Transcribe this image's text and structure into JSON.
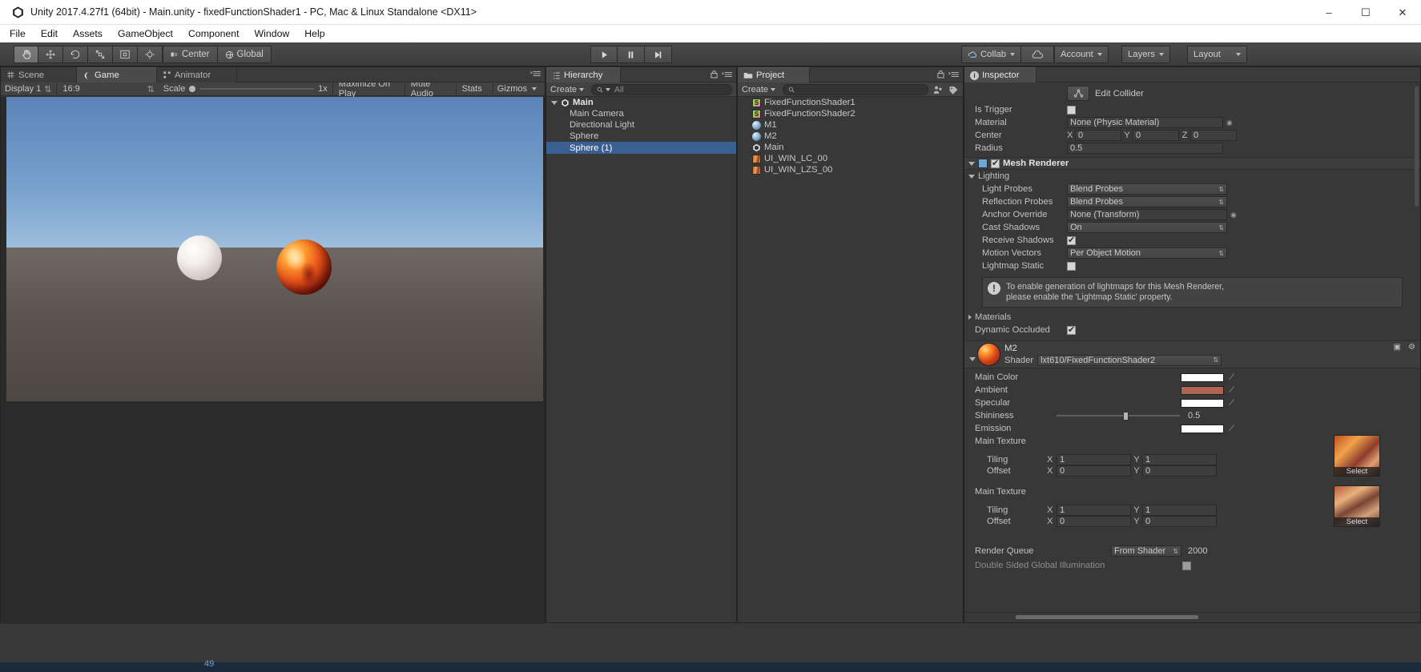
{
  "window": {
    "title": "Unity 2017.4.27f1 (64bit) - Main.unity - fixedFunctionShader1 - PC, Mac & Linux Standalone <DX11>",
    "minimize": "–",
    "maximize": "☐",
    "close": "✕"
  },
  "menu": {
    "items": [
      "File",
      "Edit",
      "Assets",
      "GameObject",
      "Component",
      "Window",
      "Help"
    ]
  },
  "toolbar": {
    "transform_tools": [
      "hand-tool",
      "move-tool",
      "rotate-tool",
      "scale-tool",
      "rect-tool",
      "transform-tool"
    ],
    "pivot_label": "Center",
    "space_label": "Global",
    "play": "▶",
    "pause": "❚❚",
    "step": "▶┃",
    "collab_label": "Collab",
    "cloud_label": "☁",
    "account_label": "Account",
    "layers_label": "Layers",
    "layout_label": "Layout"
  },
  "sceneview": {
    "tabs": [
      {
        "label": "Scene",
        "icon": "scene-grid-icon",
        "active": false
      },
      {
        "label": "Game",
        "icon": "game-pad-icon",
        "active": true
      },
      {
        "label": "Animator",
        "icon": "animator-icon",
        "active": false
      }
    ],
    "display": "Display 1",
    "aspect": "16:9",
    "scale_label": "Scale",
    "scale_value": "1x",
    "maximize_on_play": "Maximize On Play",
    "mute_audio": "Mute Audio",
    "stats": "Stats",
    "gizmos": "Gizmos"
  },
  "hierarchy": {
    "tab": "Hierarchy",
    "create": "Create",
    "search_placeholder": "All",
    "items": [
      {
        "label": "Main",
        "depth": 0,
        "selected": false,
        "icon": "unity-scene-icon",
        "expanded": true
      },
      {
        "label": "Main Camera",
        "depth": 1,
        "selected": false,
        "icon": "none"
      },
      {
        "label": "Directional Light",
        "depth": 1,
        "selected": false,
        "icon": "none"
      },
      {
        "label": "Sphere",
        "depth": 1,
        "selected": false,
        "icon": "none"
      },
      {
        "label": "Sphere (1)",
        "depth": 1,
        "selected": true,
        "icon": "none"
      }
    ]
  },
  "project": {
    "tab": "Project",
    "create": "Create",
    "search_placeholder": "",
    "items": [
      {
        "label": "FixedFunctionShader1",
        "icon": "shader-icon"
      },
      {
        "label": "FixedFunctionShader2",
        "icon": "shader-icon"
      },
      {
        "label": "M1",
        "icon": "material-icon"
      },
      {
        "label": "M2",
        "icon": "material-icon"
      },
      {
        "label": "Main",
        "icon": "unity-scene-icon"
      },
      {
        "label": "UI_WIN_LC_00",
        "icon": "texture-icon"
      },
      {
        "label": "UI_WIN_LZS_00",
        "icon": "texture-icon"
      }
    ]
  },
  "inspector": {
    "tab": "Inspector",
    "edit_collider": "Edit Collider",
    "collider": {
      "is_trigger_label": "Is Trigger",
      "is_trigger_checked": false,
      "material_label": "Material",
      "material_value": "None (Physic Material)",
      "center_label": "Center",
      "center": {
        "x_label": "X",
        "x": "0",
        "y_label": "Y",
        "y": "0",
        "z_label": "Z",
        "z": "0"
      },
      "radius_label": "Radius",
      "radius_value": "0.5"
    },
    "mesh_renderer": {
      "title": "Mesh Renderer",
      "enabled": true,
      "lighting_label": "Lighting",
      "fields": [
        {
          "label": "Light Probes",
          "value": "Blend Probes",
          "type": "popup"
        },
        {
          "label": "Reflection Probes",
          "value": "Blend Probes",
          "type": "popup"
        },
        {
          "label": "Anchor Override",
          "value": "None (Transform)",
          "type": "object"
        },
        {
          "label": "Cast Shadows",
          "value": "On",
          "type": "popup"
        },
        {
          "label": "Receive Shadows",
          "value": "",
          "type": "checkbox",
          "checked": true
        },
        {
          "label": "Motion Vectors",
          "value": "Per Object Motion",
          "type": "popup"
        },
        {
          "label": "Lightmap Static",
          "value": "",
          "type": "checkbox",
          "checked": false
        }
      ],
      "info_line1": "To enable generation of lightmaps for this Mesh Renderer,",
      "info_line2": "please enable the 'Lightmap Static' property.",
      "materials_label": "Materials",
      "dynamic_occluded_label": "Dynamic Occluded",
      "dynamic_occluded_checked": true
    },
    "material": {
      "name": "M2",
      "shader_label": "Shader",
      "shader_value": "lxt610/FixedFunctionShader2",
      "props": [
        {
          "label": "Main Color",
          "type": "color",
          "color": "#ffffff"
        },
        {
          "label": "Ambient",
          "type": "color",
          "color": "#b06454"
        },
        {
          "label": "Specular",
          "type": "color",
          "color": "#ffffff"
        },
        {
          "label": "Shininess",
          "type": "slider",
          "value": "0.5"
        },
        {
          "label": "Emission",
          "type": "color",
          "color": "#ffffff"
        }
      ],
      "textures": [
        {
          "label": "Main Texture",
          "tiling_label": "Tiling",
          "tiling_x_label": "X",
          "tiling_x": "1",
          "tiling_y_label": "Y",
          "tiling_y": "1",
          "offset_label": "Offset",
          "offset_x_label": "X",
          "offset_x": "0",
          "offset_y_label": "Y",
          "offset_y": "0",
          "select_label": "Select"
        },
        {
          "label": "Main Texture",
          "tiling_label": "Tiling",
          "tiling_x_label": "X",
          "tiling_x": "1",
          "tiling_y_label": "Y",
          "tiling_y": "1",
          "offset_label": "Offset",
          "offset_x_label": "X",
          "offset_x": "0",
          "offset_y_label": "Y",
          "offset_y": "0",
          "select_label": "Select"
        }
      ],
      "render_queue_label": "Render Queue",
      "render_queue_mode": "From Shader",
      "render_queue_value": "2000",
      "double_sided_label": "Double Sided Global Illumination",
      "double_sided_checked": false
    }
  },
  "colors": {
    "selection_blue": "#3a5f92",
    "panel_bg": "#383838",
    "toolbar_bg": "#4b4b4b"
  }
}
